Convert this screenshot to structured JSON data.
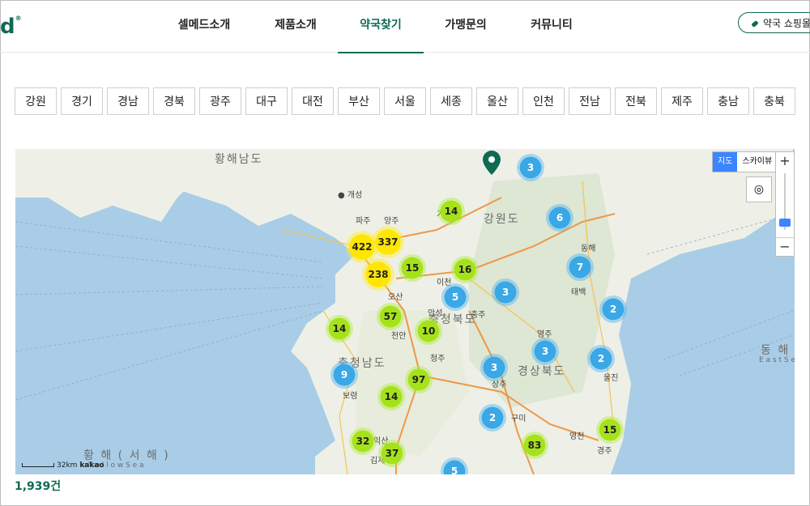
{
  "header": {
    "logo": "d",
    "logo_mark": "®",
    "nav": [
      {
        "label": "셀메드소개",
        "active": false
      },
      {
        "label": "제품소개",
        "active": false
      },
      {
        "label": "약국찾기",
        "active": true
      },
      {
        "label": "가맹문의",
        "active": false
      },
      {
        "label": "커뮤니티",
        "active": false
      }
    ],
    "shop_button": "약국 쇼핑몰",
    "accent": "#0e6b52"
  },
  "regions": [
    "강원",
    "경기",
    "경남",
    "경북",
    "광주",
    "대구",
    "대전",
    "부산",
    "서울",
    "세종",
    "울산",
    "인천",
    "전남",
    "전북",
    "제주",
    "충남",
    "충북"
  ],
  "map": {
    "type_control": {
      "map": "지도",
      "skyview": "스카이뷰",
      "selected": "지도"
    },
    "zoom_in": "+",
    "zoom_out": "−",
    "scale_label": "32km",
    "provider": "kakao",
    "labels": {
      "yellow_sea_north": "황해남도",
      "gaeseong": "개성",
      "gangwon": "강원도",
      "chungbuk": "충청북도",
      "chungnam": "충청남도",
      "gyeongbuk": "경상북도",
      "east_sea": "동 해",
      "east_sea_en": "E a s t  S e",
      "yellow_sea": "황 해 ( 서 해 )",
      "yellow_sea_en": "Y e l l o w  S e a",
      "boryeong": "보령",
      "gimje": "김제",
      "iksan": "익산",
      "cheongju": "청주",
      "cheonan": "천안",
      "ansung": "안성",
      "icheon": "이천",
      "osan": "오산",
      "paju": "파주",
      "yangju": "양주",
      "gapyeong": "가평",
      "chungju": "충주",
      "yeongju": "영주",
      "sangju": "상주",
      "taebaek": "태백",
      "gumi": "구미",
      "yeongcheon": "영천",
      "gyeongju": "경주",
      "donghae": "동해",
      "uljin": "울진"
    },
    "clusters": [
      {
        "count": "3",
        "color": "blue"
      },
      {
        "count": "14",
        "color": "green"
      },
      {
        "count": "6",
        "color": "blue"
      },
      {
        "count": "422",
        "color": "yellow"
      },
      {
        "count": "337",
        "color": "yellow"
      },
      {
        "count": "15",
        "color": "green"
      },
      {
        "count": "16",
        "color": "green"
      },
      {
        "count": "238",
        "color": "yellow"
      },
      {
        "count": "7",
        "color": "blue"
      },
      {
        "count": "5",
        "color": "blue"
      },
      {
        "count": "3",
        "color": "blue"
      },
      {
        "count": "57",
        "color": "green"
      },
      {
        "count": "2",
        "color": "blue"
      },
      {
        "count": "14",
        "color": "green"
      },
      {
        "count": "10",
        "color": "green"
      },
      {
        "count": "3",
        "color": "blue"
      },
      {
        "count": "2",
        "color": "blue"
      },
      {
        "count": "9",
        "color": "blue"
      },
      {
        "count": "3",
        "color": "blue"
      },
      {
        "count": "97",
        "color": "green"
      },
      {
        "count": "14",
        "color": "green"
      },
      {
        "count": "2",
        "color": "blue"
      },
      {
        "count": "15",
        "color": "green"
      },
      {
        "count": "32",
        "color": "green"
      },
      {
        "count": "83",
        "color": "green"
      },
      {
        "count": "37",
        "color": "green"
      },
      {
        "count": "5",
        "color": "blue"
      }
    ]
  },
  "result_count": "1,939건"
}
